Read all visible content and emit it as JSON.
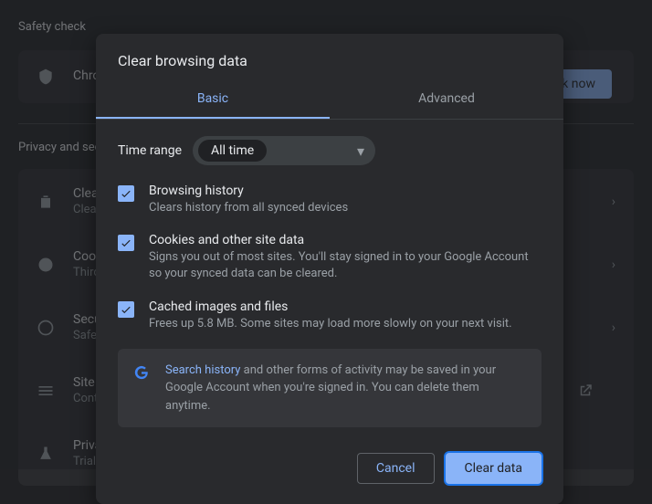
{
  "background": {
    "safety_title": "Safety check",
    "check_row": {
      "title": "Chrome",
      "sub": ""
    },
    "check_btn": "Check now",
    "privacy_title": "Privacy and security",
    "rows": [
      {
        "title": "Clear browsing data",
        "sub": "Clear history, cookies, cache, and more"
      },
      {
        "title": "Cookies and other site data",
        "sub": "Third-party cookies are blocked in Incognito mode"
      },
      {
        "title": "Security",
        "sub": "Safe Browsing (protection from dangerous sites) and other security settings"
      },
      {
        "title": "Site Settings",
        "sub": "Controls what information sites can use and show"
      },
      {
        "title": "Privacy Sandbox",
        "sub": "Trial features are on"
      }
    ]
  },
  "dialog": {
    "title": "Clear browsing data",
    "tabs": {
      "basic": "Basic",
      "advanced": "Advanced"
    },
    "time_range_label": "Time range",
    "time_range_value": "All time",
    "options": [
      {
        "title": "Browsing history",
        "sub": "Clears history from all synced devices"
      },
      {
        "title": "Cookies and other site data",
        "sub": "Signs you out of most sites. You'll stay signed in to your Google Account so your synced data can be cleared."
      },
      {
        "title": "Cached images and files",
        "sub": "Frees up 5.8 MB. Some sites may load more slowly on your next visit."
      }
    ],
    "info": {
      "link_text": "Search history",
      "rest": " and other forms of activity may be saved in your Google Account when you're signed in. You can delete them anytime."
    },
    "buttons": {
      "cancel": "Cancel",
      "clear": "Clear data"
    }
  }
}
